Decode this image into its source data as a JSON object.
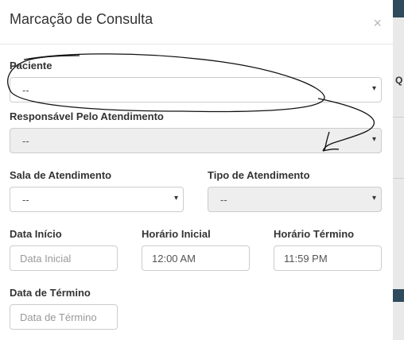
{
  "modal": {
    "title": "Marcação de Consulta",
    "close_symbol": "×"
  },
  "fields": {
    "paciente": {
      "label": "Paciente",
      "value": "--"
    },
    "responsavel": {
      "label": "Responsável Pelo Atendimento",
      "value": "--"
    },
    "sala": {
      "label": "Sala de Atendimento",
      "value": "--"
    },
    "tipo": {
      "label": "Tipo de Atendimento",
      "value": "--"
    },
    "data_inicio": {
      "label": "Data Início",
      "placeholder": "Data Inicial"
    },
    "horario_inicial": {
      "label": "Horário Inicial",
      "value": "12:00 AM"
    },
    "horario_termino": {
      "label": "Horário Término",
      "value": "11:59 PM"
    },
    "data_termino": {
      "label": "Data de Término",
      "placeholder": "Data de Término"
    }
  },
  "caret_symbol": "▾",
  "background_page": {
    "partial_text": "Q"
  },
  "colors": {
    "annotation_ink": "#111111",
    "disabled_bg": "#eeeeee",
    "border": "#cccccc"
  }
}
